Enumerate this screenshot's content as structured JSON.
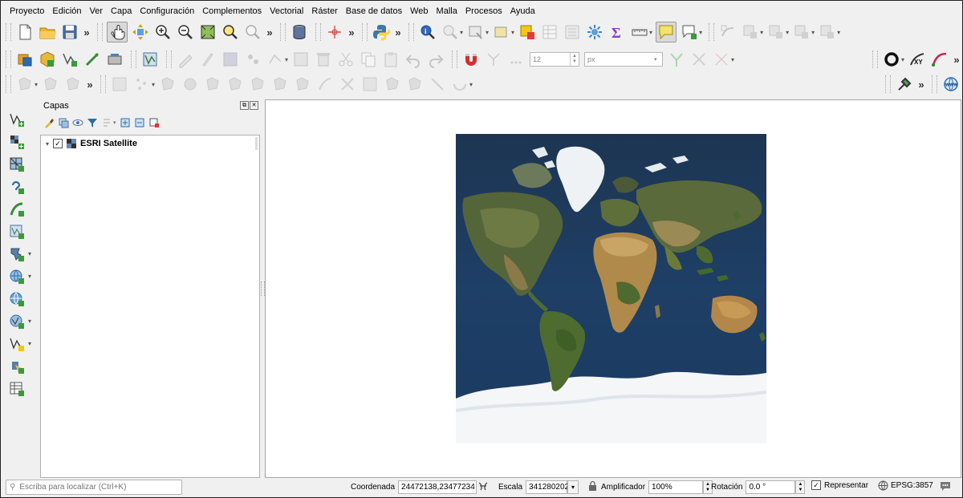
{
  "menu": [
    "Proyecto",
    "Edición",
    "Ver",
    "Capa",
    "Configuración",
    "Complementos",
    "Vectorial",
    "Ráster",
    "Base de datos",
    "Web",
    "Malla",
    "Procesos",
    "Ayuda"
  ],
  "toolbar2": {
    "size_value": "12",
    "unit_value": "px"
  },
  "layers_panel": {
    "title": "Capas",
    "layers": [
      {
        "name": "ESRI Satellite",
        "checked": "✓",
        "expander": "▾"
      }
    ]
  },
  "map": {
    "description_hidden": ""
  },
  "status": {
    "locator_placeholder": "Escriba para localizar (Ctrl+K)",
    "coord_label": "Coordenada",
    "coord_value": "24472138,23477234",
    "scale_label": "Escala",
    "scale_value": "341280202",
    "magnifier_label": "Amplificador",
    "magnifier_value": "100%",
    "rotation_label": "Rotación",
    "rotation_value": "0.0 °",
    "render_label": "Representar",
    "render_checked": "✓",
    "crs_value": "EPSG:3857"
  },
  "icons": {
    "accent_yellow": "#f5c518",
    "accent_blue": "#2b6cb0",
    "accent_green": "#3a9a3a"
  }
}
